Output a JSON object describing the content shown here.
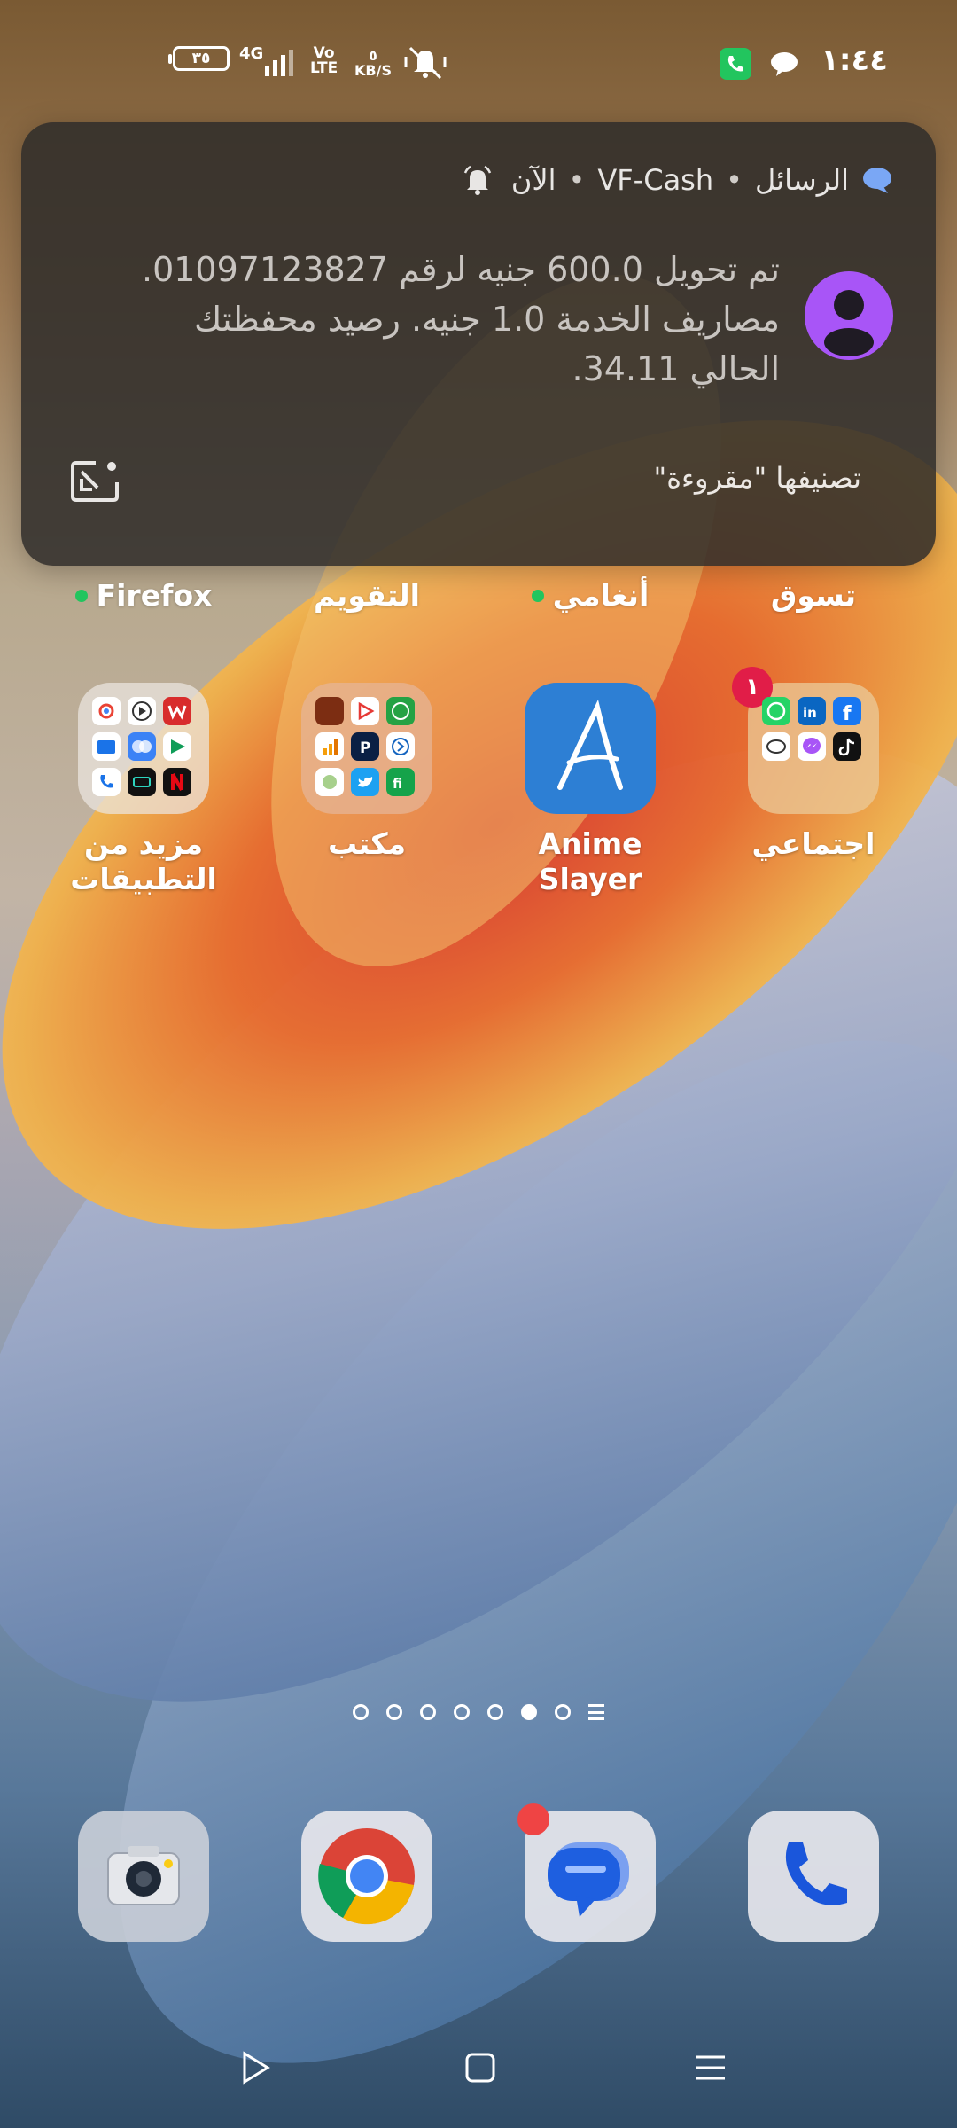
{
  "status_bar": {
    "time": "١:٤٤",
    "battery": "٣٥",
    "network": "4G",
    "volte": "Vo\nLTE",
    "speed": "٥\nKB/S"
  },
  "notification": {
    "app": "الرسائل",
    "sender": "VF-Cash",
    "time": "الآن",
    "separator": "•",
    "body": "تم تحويل 600.0 جنيه لرقم 01097123827. مصاريف الخدمة 1.0 جنيه. رصيد محفظتك الحالي 34.11.",
    "action": "تصنيفها \"مقروءة\""
  },
  "top_labels": {
    "firefox": "Firefox",
    "calendar": "التقويم",
    "music": "أنغامي",
    "shopping": "تسوق"
  },
  "apps": {
    "more_apps": "مزيد من التطبيقات",
    "office": "مكتب",
    "anime_slayer": "Anime Slayer",
    "social": "اجتماعي",
    "social_badge": "١"
  },
  "page_indicator": {
    "count": 7,
    "active_index": 5
  },
  "colors": {
    "notification_bg": "#2e2c2a",
    "avatar": "#a855f7",
    "badge": "#e11d48",
    "anime_tile": "#2d7fd4",
    "accent_green": "#22c55e"
  },
  "icons": [
    "camera-icon",
    "chrome-icon",
    "messages-icon",
    "phone-icon",
    "back-icon",
    "home-icon",
    "recents-icon"
  ]
}
